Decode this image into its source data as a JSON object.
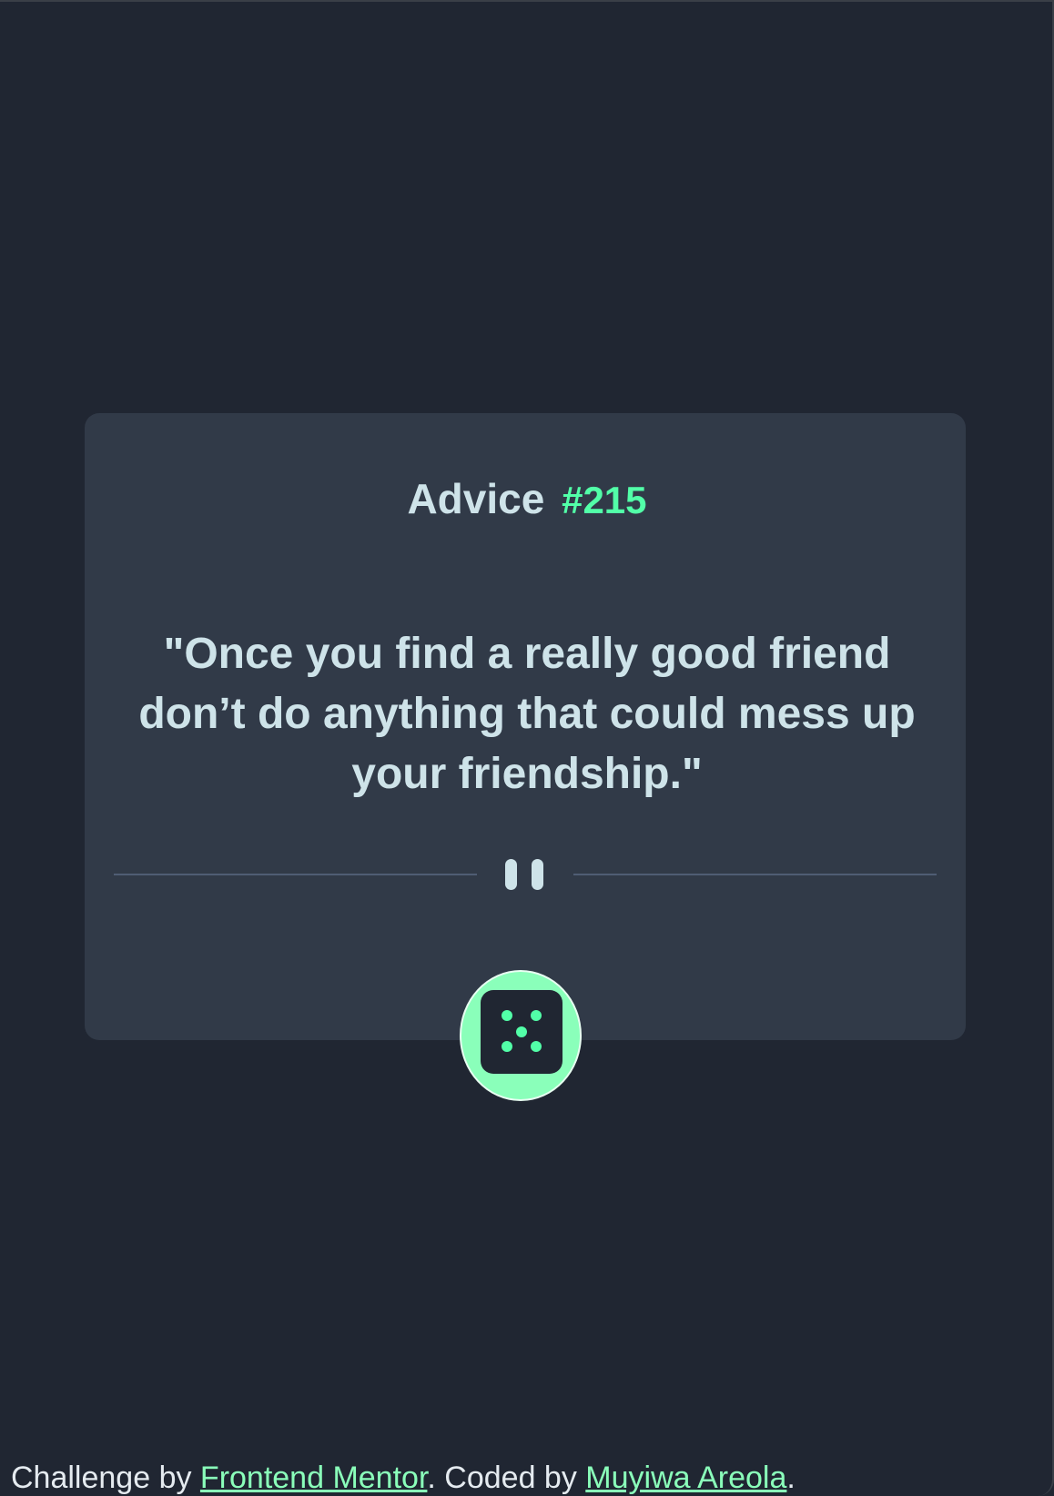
{
  "advice": {
    "label": "Advice",
    "number": "#215",
    "quote": "\"Once you find a really good friend don’t do anything that could mess up your friendship.\""
  },
  "divider": {
    "icon": "pause-icon"
  },
  "dice_button": {
    "icon": "dice-icon"
  },
  "footer": {
    "prefix": "Challenge by ",
    "link1": "Frontend Mentor",
    "middle": ". Coded by ",
    "link2": "Muyiwa Areola",
    "suffix": "."
  },
  "colors": {
    "background": "#202632",
    "card": "#313a48",
    "accent": "#52ffa8",
    "text": "#cee3e9",
    "divider": "#4f5d74"
  }
}
